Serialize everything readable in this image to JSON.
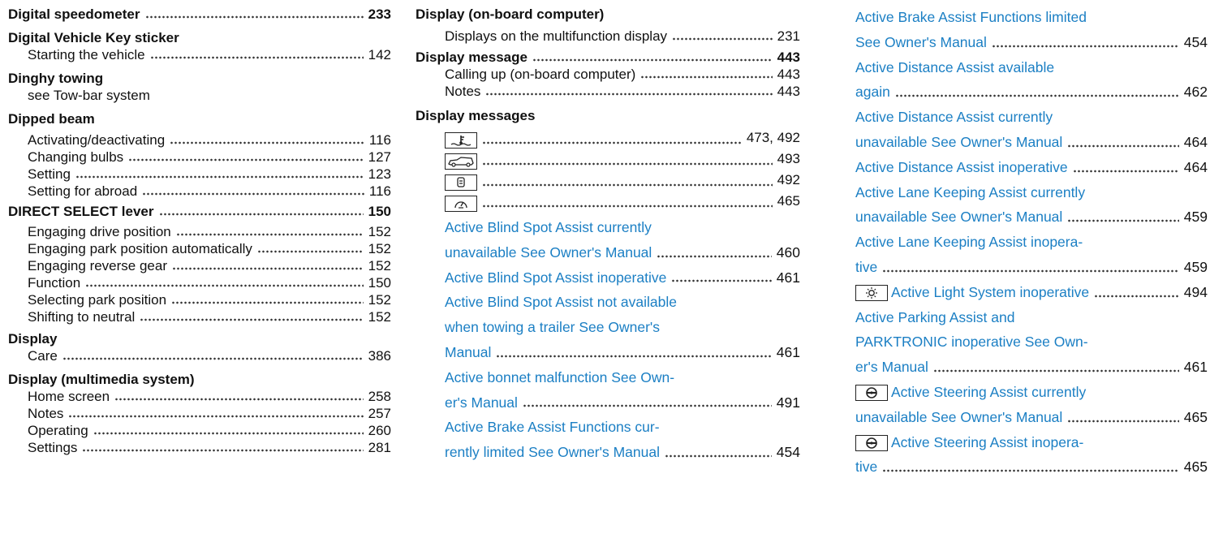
{
  "col1": [
    {
      "type": "head",
      "label": "Digital speedometer",
      "page": "233"
    },
    {
      "type": "head",
      "label": "Digital Vehicle Key sticker",
      "page": ""
    },
    {
      "type": "sub",
      "label": "Starting the vehicle",
      "page": "142"
    },
    {
      "type": "head",
      "label": "Dinghy towing",
      "page": ""
    },
    {
      "type": "sub",
      "label": "see Tow-bar system",
      "page": ""
    },
    {
      "type": "head",
      "label": "Dipped beam",
      "page": ""
    },
    {
      "type": "sub",
      "label": "Activating/deactivating",
      "page": "116"
    },
    {
      "type": "sub",
      "label": "Changing bulbs",
      "page": "127"
    },
    {
      "type": "sub",
      "label": "Setting",
      "page": "123"
    },
    {
      "type": "sub",
      "label": "Setting for abroad",
      "page": "116"
    },
    {
      "type": "head",
      "label": "DIRECT SELECT lever",
      "page": "150"
    },
    {
      "type": "sub",
      "label": "Engaging drive position",
      "page": "152"
    },
    {
      "type": "sub",
      "label": "Engaging park position automatically",
      "page": "152"
    },
    {
      "type": "sub",
      "label": "Engaging reverse gear",
      "page": "152"
    },
    {
      "type": "sub",
      "label": "Function",
      "page": "150"
    },
    {
      "type": "sub",
      "label": "Selecting park position",
      "page": "152"
    },
    {
      "type": "sub",
      "label": "Shifting to neutral",
      "page": "152"
    },
    {
      "type": "head",
      "label": "Display",
      "page": ""
    },
    {
      "type": "sub",
      "label": "Care",
      "page": "386"
    },
    {
      "type": "head",
      "label": "Display (multimedia system)",
      "page": ""
    },
    {
      "type": "sub",
      "label": "Home screen",
      "page": "258"
    },
    {
      "type": "sub",
      "label": "Notes",
      "page": "257"
    },
    {
      "type": "sub",
      "label": "Operating",
      "page": "260"
    },
    {
      "type": "sub",
      "label": "Settings",
      "page": "281"
    }
  ],
  "col2": {
    "head_computer": "Display (on-board computer)",
    "sub_multifunction": {
      "label": "Displays on the multifunction display",
      "page": "231"
    },
    "head_message": {
      "label": "Display message",
      "page": "443"
    },
    "sub_calling": {
      "label": "Calling up (on-board computer)",
      "page": "443"
    },
    "sub_notes": {
      "label": "Notes",
      "page": "443"
    },
    "head_messages": "Display messages",
    "icons": [
      {
        "icon": "coolant-temperature-icon",
        "page": "473, 492"
      },
      {
        "icon": "car-side-icon",
        "page": "493"
      },
      {
        "icon": "seat-occupancy-icon",
        "page": "492"
      },
      {
        "icon": "speedometer-icon",
        "page": "465"
      }
    ],
    "bsa_unavail_l1": "Active Blind Spot Assist currently",
    "bsa_unavail_l2": "unavailable See Owner's Manual",
    "bsa_unavail_page": "460",
    "bsa_inop": "Active Blind Spot Assist inoperative",
    "bsa_inop_page": "461",
    "bsa_trailer_l1": "Active Blind Spot Assist not available",
    "bsa_trailer_l2": "when towing a trailer See Owner's",
    "bsa_trailer_l3": "Manual",
    "bsa_trailer_page": "461",
    "bonnet_l1": "Active bonnet malfunction See Own-",
    "bonnet_l2": "er's Manual",
    "bonnet_page": "491",
    "brake_l1": "Active Brake Assist Functions cur-",
    "brake_l2": "rently limited See Owner's Manual",
    "brake_page": "454"
  },
  "col3": {
    "brake_l1": "Active Brake Assist Functions limited",
    "brake_l2": "See Owner's Manual",
    "brake_page": "454",
    "distance_avail_l1": "Active Distance Assist available",
    "distance_avail_l2": "again",
    "distance_avail_page": "462",
    "distance_unavail_l1": "Active Distance Assist currently",
    "distance_unavail_l2": "unavailable See Owner's Manual",
    "distance_unavail_page": "464",
    "distance_inop": "Active Distance Assist inoperative",
    "distance_inop_page": "464",
    "lane_unavail_l1": "Active Lane Keeping Assist currently",
    "lane_unavail_l2": "unavailable See Owner's Manual",
    "lane_unavail_page": "459",
    "lane_inop_l1": "Active Lane Keeping Assist inopera-",
    "lane_inop_l2": "tive",
    "lane_inop_page": "459",
    "light_inop": "Active Light System inoperative",
    "light_inop_page": "494",
    "parking_l1": "Active Parking Assist and",
    "parking_l2": "PARKTRONIC inoperative See Own-",
    "parking_l3": "er's Manual",
    "parking_page": "461",
    "steer_unavail_l1": "Active Steering Assist currently",
    "steer_unavail_l2": "unavailable See Owner's Manual",
    "steer_unavail_page": "465",
    "steer_inop_l1": "Active Steering Assist inopera-",
    "steer_inop_l2": "tive",
    "steer_inop_page": "465"
  },
  "colors": {
    "link_blue": "#1b7fc4",
    "text": "#111111"
  }
}
